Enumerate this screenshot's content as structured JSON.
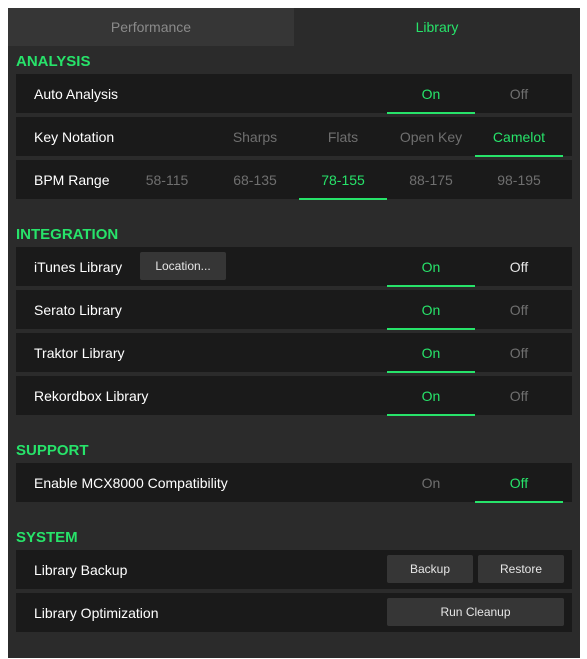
{
  "tabs": {
    "performance": "Performance",
    "library": "Library"
  },
  "analysis": {
    "header": "ANALYSIS",
    "auto_analysis": {
      "label": "Auto Analysis",
      "on": "On",
      "off": "Off",
      "selected": "On"
    },
    "key_notation": {
      "label": "Key Notation",
      "options": [
        "Sharps",
        "Flats",
        "Open Key",
        "Camelot"
      ],
      "selected": "Camelot"
    },
    "bpm_range": {
      "label": "BPM Range",
      "options": [
        "58-115",
        "68-135",
        "78-155",
        "88-175",
        "98-195"
      ],
      "selected": "78-155"
    }
  },
  "integration": {
    "header": "INTEGRATION",
    "itunes": {
      "label": "iTunes Library",
      "location_button": "Location...",
      "on": "On",
      "off": "Off",
      "selected": "On"
    },
    "serato": {
      "label": "Serato Library",
      "on": "On",
      "off": "Off",
      "selected": "On"
    },
    "traktor": {
      "label": "Traktor Library",
      "on": "On",
      "off": "Off",
      "selected": "On"
    },
    "rekordbox": {
      "label": "Rekordbox Library",
      "on": "On",
      "off": "Off",
      "selected": "On"
    }
  },
  "support": {
    "header": "SUPPORT",
    "mcx8000": {
      "label": "Enable MCX8000 Compatibility",
      "on": "On",
      "off": "Off",
      "selected": "Off"
    }
  },
  "system": {
    "header": "SYSTEM",
    "backup": {
      "label": "Library Backup",
      "backup_button": "Backup",
      "restore_button": "Restore"
    },
    "optimization": {
      "label": "Library Optimization",
      "cleanup_button": "Run Cleanup"
    }
  },
  "colors": {
    "accent": "#27e36a",
    "panel": "#2b2b2b",
    "row": "#1a1a1a",
    "button": "#363636",
    "muted": "#6f6f6f"
  }
}
